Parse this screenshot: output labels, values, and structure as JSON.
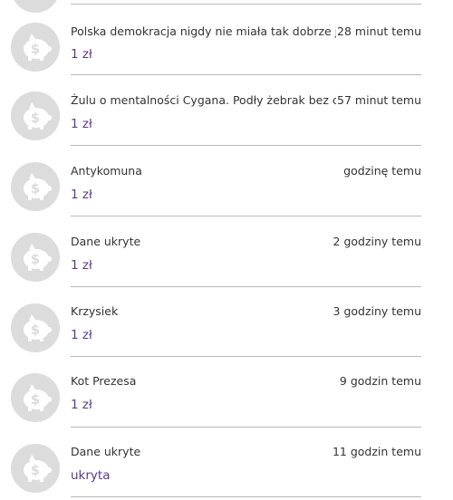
{
  "donations": [
    {
      "name": "Polska demokracja nigdy nie miała tak dobrze jak za",
      "time": "28 minut temu",
      "amount": "1 zł",
      "icon": "piggy-bank-dollar-icon"
    },
    {
      "name": "Żulu o mentalności Cygana. Podły żebrak bez cienia",
      "time": "57 minut temu",
      "amount": "1 zł",
      "icon": "piggy-bank-dollar-icon"
    },
    {
      "name": "Antykomuna",
      "time": "godzinę temu",
      "amount": "1 zł",
      "icon": "piggy-bank-dollar-icon"
    },
    {
      "name": "Dane ukryte",
      "time": "2 godziny temu",
      "amount": "1 zł",
      "icon": "piggy-bank-dollar-icon"
    },
    {
      "name": "Krzysiek",
      "time": "3 godziny temu",
      "amount": "1 zł",
      "icon": "piggy-bank-dollar-icon"
    },
    {
      "name": "Kot Prezesa",
      "time": "9 godzin temu",
      "amount": "1 zł",
      "icon": "piggy-bank-dollar-icon"
    },
    {
      "name": "Dane ukryte",
      "time": "11 godzin temu",
      "amount": "ukryta",
      "icon": "piggy-bank-dollar-icon"
    }
  ],
  "colors": {
    "amount": "#5b3a8c",
    "text": "#333333",
    "avatar": "#dcdcdc",
    "separator": "#b9b9b9"
  }
}
